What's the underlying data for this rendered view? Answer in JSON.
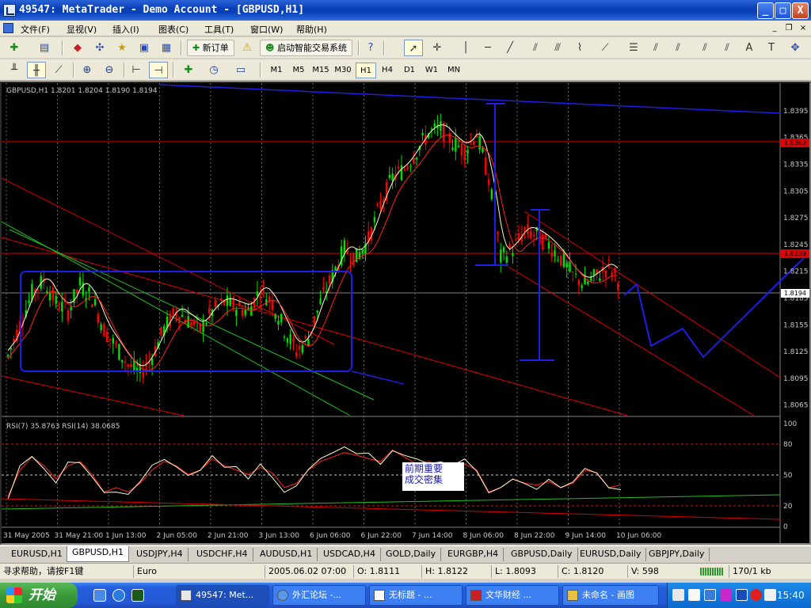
{
  "window": {
    "title": "49547: MetaTrader - Demo Account - [GBPUSD,H1]",
    "minimize": "_",
    "maximize": "□",
    "close": "X"
  },
  "menu": {
    "items": [
      "文件(F)",
      "显视(V)",
      "插入(I)",
      "图表(C)",
      "工具(T)",
      "窗口(W)",
      "帮助(H)"
    ],
    "mdi_min": "_",
    "mdi_restore": "❐",
    "mdi_close": "×"
  },
  "toolbar1": {
    "new_order": "新订单",
    "expert_advisors": "启动智能交易系统",
    "text_tool": "A"
  },
  "toolbar2": {
    "periods": [
      "M1",
      "M5",
      "M15",
      "M30",
      "H1",
      "H4",
      "D1",
      "W1",
      "MN"
    ],
    "active_period": "H1"
  },
  "chart": {
    "header": "GBPUSD,H1  1.8201 1.8204 1.8190 1.8194",
    "rsi_header": "RSI(7) 35.8763  RSI(14) 38.0685",
    "annotation": [
      "前期重要",
      "成交密集"
    ],
    "current_price_label": "1.8194",
    "red_level_1": "1.8363",
    "red_level_2": "1.8239",
    "colors": {
      "background": "#000000",
      "bull_candle": "#00e000",
      "bear_candle": "#ff0000",
      "ma_fast": "#fffbc8",
      "ma_slow": "#ff2020",
      "drawings": "#1e1ee6",
      "trend_red": "#e00000",
      "trend_green": "#20c020",
      "grid": "#666666"
    }
  },
  "chart_data": {
    "type": "line",
    "title": "GBPUSD,H1",
    "price_ticks": [
      "1.8395",
      "1.8365",
      "1.8335",
      "1.8305",
      "1.8275",
      "1.8245",
      "1.8215",
      "1.8185",
      "1.8155",
      "1.8125",
      "1.8095",
      "1.8065"
    ],
    "rsi_ticks": [
      "100",
      "80",
      "50",
      "20",
      "0"
    ],
    "time_labels": [
      "31 May 2005",
      "31 May 21:00",
      "1 Jun 13:00",
      "2 Jun 05:00",
      "2 Jun 21:00",
      "3 Jun 13:00",
      "6 Jun 06:00",
      "6 Jun 22:00",
      "7 Jun 14:00",
      "8 Jun 06:00",
      "8 Jun 22:00",
      "9 Jun 14:00",
      "10 Jun 06:00"
    ],
    "ylim": [
      1.8055,
      1.841
    ],
    "series": [
      {
        "values": [
          1.812,
          1.8155,
          1.819,
          1.8205,
          1.818,
          1.817,
          1.82,
          1.8185,
          1.815,
          1.813,
          1.811,
          1.81,
          1.812,
          1.815,
          1.817,
          1.816,
          1.815,
          1.817,
          1.818,
          1.8175,
          1.817,
          1.8195,
          1.818,
          1.815,
          1.8125,
          1.814,
          1.818,
          1.821,
          1.824,
          1.823,
          1.825,
          1.829,
          1.832,
          1.833,
          1.835,
          1.837,
          1.8375,
          1.836,
          1.835,
          1.837,
          1.832,
          1.823,
          1.824,
          1.826,
          1.8255,
          1.8245,
          1.823,
          1.821,
          1.82,
          1.821,
          1.822,
          1.82
        ]
      }
    ],
    "rsi": [
      {
        "name": "RSI(7)",
        "values": [
          25,
          55,
          70,
          60,
          45,
          60,
          65,
          50,
          30,
          35,
          30,
          40,
          55,
          65,
          60,
          50,
          55,
          68,
          60,
          55,
          50,
          58,
          52,
          35,
          40,
          55,
          65,
          70,
          75,
          72,
          68,
          65,
          78,
          70,
          62,
          65,
          60,
          58,
          62,
          55,
          30,
          35,
          45,
          40,
          38,
          42,
          35,
          40,
          55,
          52,
          35,
          38
        ]
      }
    ]
  },
  "tabs": [
    "EURUSD,H1",
    "GBPUSD,H1",
    "USDJPY,H4",
    "USDCHF,H4",
    "AUDUSD,H1",
    "USDCAD,H4",
    "GOLD,Daily",
    "EURGBP,H4",
    "GBPUSD,Daily",
    "EURUSD,Daily",
    "GBPJPY,Daily"
  ],
  "active_tab": "GBPUSD,H1",
  "status": {
    "help": "寻求帮助，请按F1键",
    "profile": "Euro",
    "datetime": "2005.06.02 07:00",
    "open": "O: 1.8111",
    "high": "H: 1.8122",
    "low": "L: 1.8093",
    "close": "C: 1.8120",
    "volume": "V: 598",
    "traffic": "170/1 kb"
  },
  "taskbar": {
    "start": "开始",
    "tasks": [
      "49547: Met...",
      "外汇论坛 -...",
      "无标题 - ...",
      "文华财经 ...",
      "未命名 - 画图"
    ],
    "clock": "15:40"
  }
}
